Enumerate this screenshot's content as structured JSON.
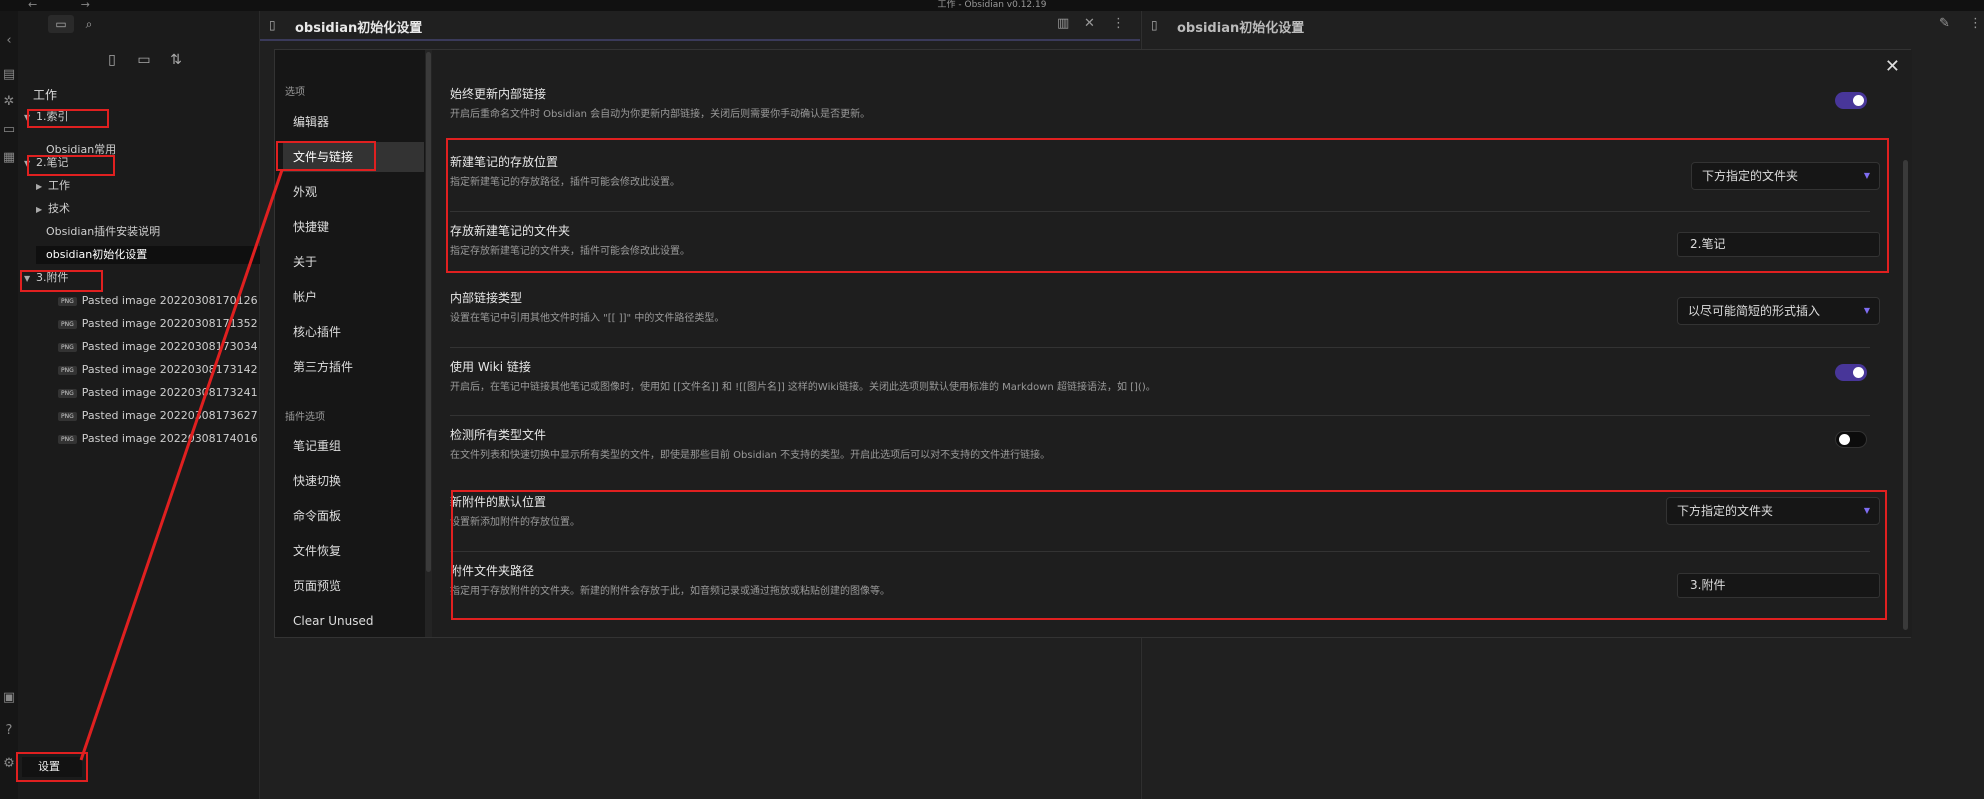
{
  "titlebar": {
    "title": "工作 - Obsidian v0.12.19",
    "nav": "← →"
  },
  "explorer": {
    "actions": [
      "new-note",
      "new-folder",
      "sort"
    ],
    "vault_name": "工作",
    "items": [
      {
        "label": "1.索引",
        "type": "folder",
        "expanded": true
      },
      {
        "label": "Obsidian常用",
        "type": "file"
      },
      {
        "label": "2.笔记",
        "type": "folder",
        "expanded": true
      },
      {
        "label": "工作",
        "type": "folder",
        "expanded": false
      },
      {
        "label": "技术",
        "type": "folder",
        "expanded": false
      },
      {
        "label": "Obsidian插件安装说明",
        "type": "file"
      },
      {
        "label": "obsidian初始化设置",
        "type": "file",
        "active": true
      },
      {
        "label": "3.附件",
        "type": "folder",
        "expanded": true
      },
      {
        "label": "Pasted image 20220308170126",
        "type": "png"
      },
      {
        "label": "Pasted image 20220308171352",
        "type": "png"
      },
      {
        "label": "Pasted image 20220308173034",
        "type": "png"
      },
      {
        "label": "Pasted image 20220308173142",
        "type": "png"
      },
      {
        "label": "Pasted image 20220308173241",
        "type": "png"
      },
      {
        "label": "Pasted image 20220308173627",
        "type": "png"
      },
      {
        "label": "Pasted image 20220308174016",
        "type": "png"
      }
    ],
    "png_badge": "PNG",
    "settings_label": "设置"
  },
  "editor_left": {
    "title": "obsidian初始化设置"
  },
  "editor_right": {
    "title": "obsidian初始化设置"
  },
  "settings": {
    "section_options": "选项",
    "nav_options": [
      "编辑器",
      "文件与链接",
      "外观",
      "快捷键",
      "关于",
      "帐户",
      "核心插件",
      "第三方插件"
    ],
    "section_plugin_options": "插件选项",
    "nav_plugins": [
      "笔记重组",
      "快速切换",
      "命令面板",
      "文件恢复",
      "页面预览",
      "Clear Unused"
    ],
    "active_nav": "文件与链接",
    "rows": [
      {
        "name": "始终更新内部链接",
        "desc": "开启后重命名文件时 Obsidian 会自动为你更新内部链接，关闭后则需要你手动确认是否更新。",
        "control": "toggle",
        "on": true
      },
      {
        "name": "新建笔记的存放位置",
        "desc": "指定新建笔记的存放路径，插件可能会修改此设置。",
        "control": "dropdown",
        "value": "下方指定的文件夹"
      },
      {
        "name": "存放新建笔记的文件夹",
        "desc": "指定存放新建笔记的文件夹，插件可能会修改此设置。",
        "control": "text",
        "value": "2.笔记"
      },
      {
        "name": "内部链接类型",
        "desc": "设置在笔记中引用其他文件时插入 \"[[ ]]\" 中的文件路径类型。",
        "control": "dropdown",
        "value": "以尽可能简短的形式插入"
      },
      {
        "name": "使用 Wiki 链接",
        "desc": "开启后，在笔记中链接其他笔记或图像时，使用如 [[文件名]] 和 ![[图片名]] 这样的Wiki链接。关闭此选项则默认使用标准的 Markdown 超链接语法，如 []()。",
        "control": "toggle",
        "on": true
      },
      {
        "name": "检测所有类型文件",
        "desc": "在文件列表和快速切换中显示所有类型的文件，即使是那些目前 Obsidian 不支持的类型。开启此选项后可以对不支持的文件进行链接。",
        "control": "toggle",
        "on": false
      },
      {
        "name": "新附件的默认位置",
        "desc": "设置新添加附件的存放位置。",
        "control": "dropdown",
        "value": "下方指定的文件夹"
      },
      {
        "name": "附件文件夹路径",
        "desc": "指定用于存放附件的文件夹。新建的附件会存放于此，如音频记录或通过拖放或粘贴创建的图像等。",
        "control": "text",
        "value": "3.附件"
      }
    ]
  },
  "colors": {
    "accent": "#7f6df2",
    "toggle_on": "#483699",
    "annotation": "#e02020"
  }
}
